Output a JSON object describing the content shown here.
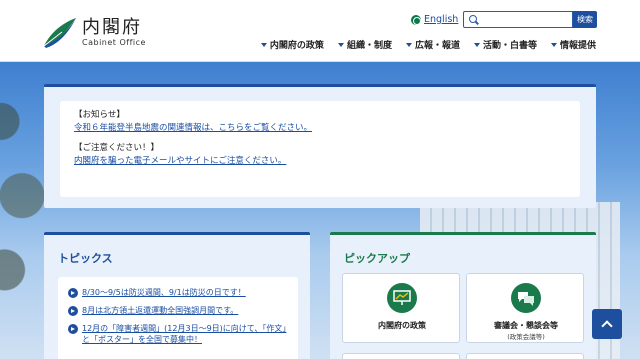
{
  "header": {
    "logo_jp": "内閣府",
    "logo_en": "Cabinet Office",
    "language_link": "English",
    "search_placeholder": "",
    "search_button": "検索"
  },
  "nav": {
    "items": [
      {
        "label": "内閣府の政策"
      },
      {
        "label": "組織・制度"
      },
      {
        "label": "広報・報道"
      },
      {
        "label": "活動・白書等"
      },
      {
        "label": "情報提供"
      }
    ]
  },
  "notice": {
    "heading1": "【お知らせ】",
    "link1": "令和６年能登半島地震の関連情報は、こちらをご覧ください。",
    "heading2": "【ご注意ください！】",
    "link2": "内閣府を騙った電子メールやサイトにご注意ください。"
  },
  "topics": {
    "title": "トピックス",
    "items": [
      "8/30～9/5は防災週間、9/1は防災の日です！",
      "8月は北方領土返還運動全国強調月間です。",
      "12月の「障害者週間」(12月3日～9日)に向けて、「作文」と「ポスター」を全国で募集中！"
    ]
  },
  "pickup": {
    "title": "ピックアップ",
    "cards": [
      {
        "label": "内閣府の政策",
        "sub": ""
      },
      {
        "label": "審議会・懇談会等",
        "sub": "(政策会議等)"
      }
    ]
  },
  "colors": {
    "brand_blue": "#1d4f9e",
    "brand_green": "#1a7a4c",
    "link": "#1a4ea3"
  }
}
